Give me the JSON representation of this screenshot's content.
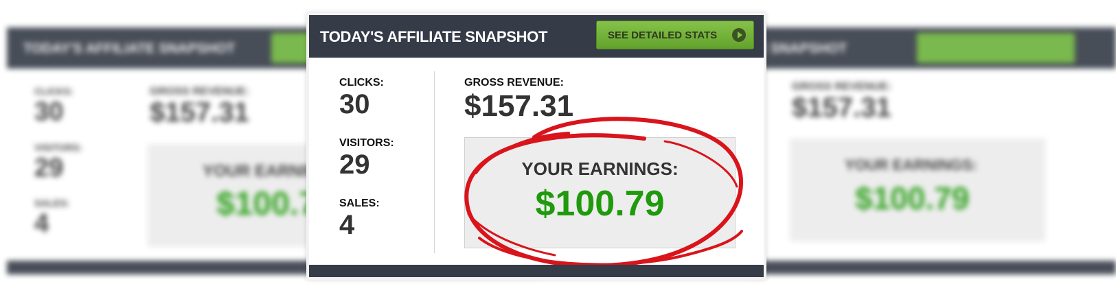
{
  "card": {
    "title": "TODAY'S AFFILIATE SNAPSHOT",
    "button_label": "SEE DETAILED STATS"
  },
  "stats": {
    "clicks_label": "CLICKS:",
    "clicks_value": "30",
    "visitors_label": "VISITORS:",
    "visitors_value": "29",
    "sales_label": "SALES:",
    "sales_value": "4",
    "gross_label": "GROSS REVENUE:",
    "gross_value": "$157.31",
    "earnings_label": "YOUR EARNINGS:",
    "earnings_value": "$100.79"
  },
  "icons": {
    "button_icon": "play-circle-icon"
  },
  "colors": {
    "header_bg": "#353b47",
    "button_green": "#6bb23a",
    "earnings_green": "#1f9a0c",
    "highlight_red": "#d9141b"
  }
}
